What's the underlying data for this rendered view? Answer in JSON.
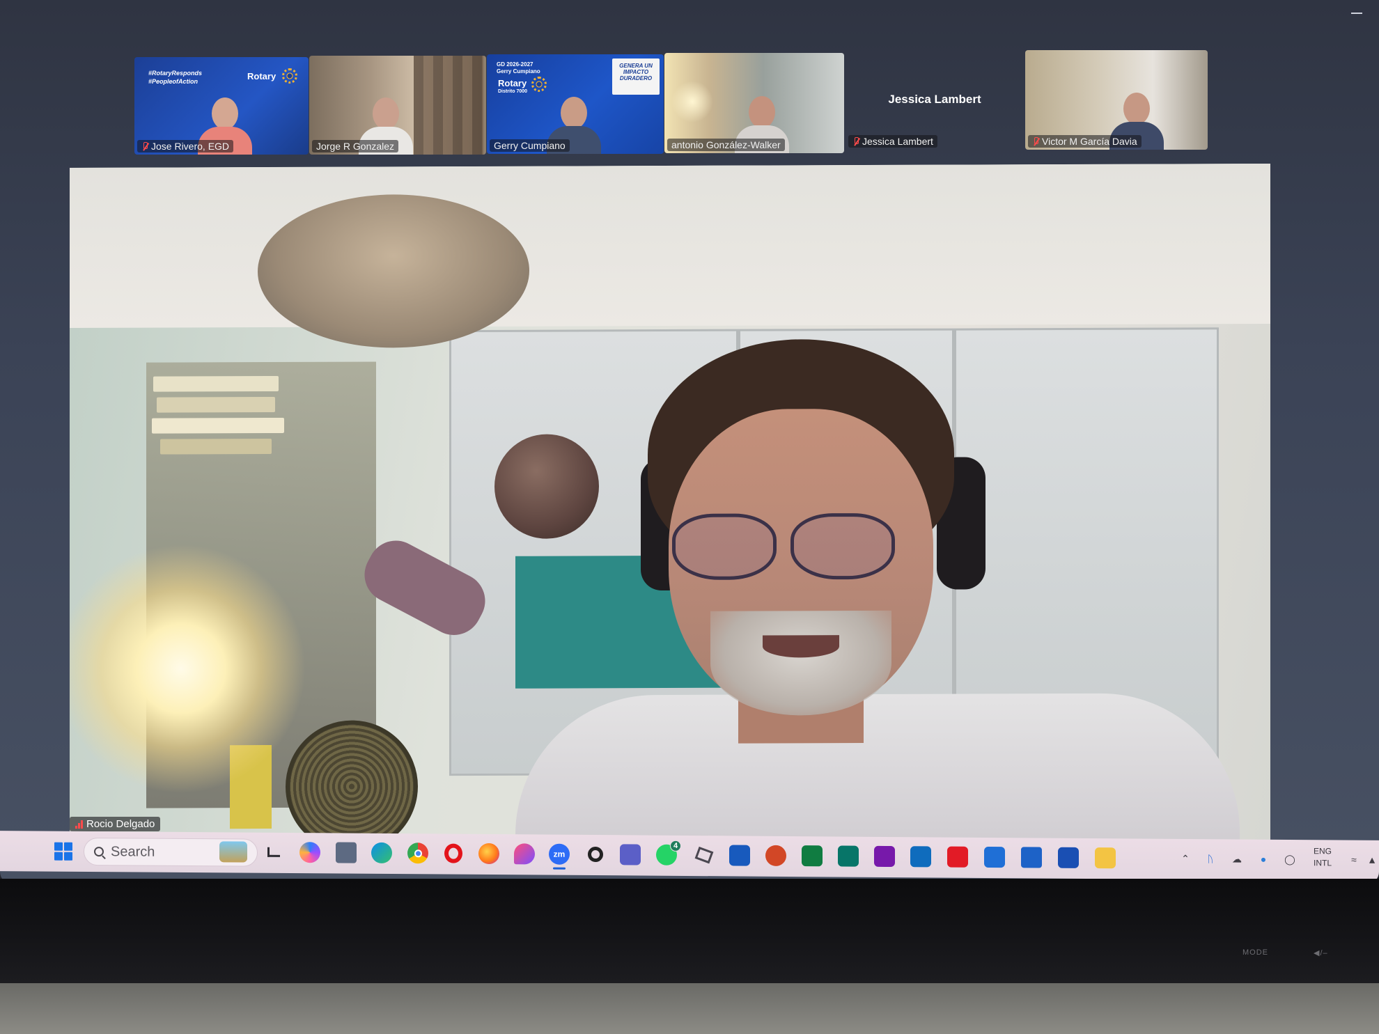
{
  "participants": {
    "thumbnails": [
      {
        "name": "Jose Rivero, EGD",
        "muted": true,
        "banner_lines": [
          "#RotaryResponds",
          "#PeopleofAction"
        ],
        "logo_text": "Rotary"
      },
      {
        "name": "Jorge R Gonzalez",
        "muted": false
      },
      {
        "name": "Gerry Cumpiano",
        "muted": false,
        "banner_lines": [
          "GD 2026-2027",
          "Gerry Cumpiano",
          "Rotary",
          "Distrito 7000"
        ],
        "slogan_lines": [
          "GENERA UN",
          "IMPACTO",
          "DURADERO"
        ]
      },
      {
        "name": "antonio González-Walker",
        "muted": false
      },
      {
        "name": "Jessica Lambert",
        "muted": true,
        "camera_off": true,
        "display_name": "Jessica Lambert"
      },
      {
        "name": "Victor M García Davia",
        "muted": true
      }
    ],
    "active_speaker": {
      "name": "Rocio Delgado"
    }
  },
  "taskbar": {
    "search_label": "Search",
    "whatsapp_badge": "4",
    "zoom_label": "zm",
    "icons": [
      "windows-start-icon",
      "search-icon",
      "widgets-icon",
      "task-view-icon",
      "copilot-icon",
      "calculator-icon",
      "edge-icon",
      "chrome-icon",
      "opera-icon",
      "firefox-icon",
      "arc-icon",
      "zoom-icon",
      "app-a-icon",
      "teams-icon",
      "whatsapp-icon",
      "snipping-icon",
      "word-icon",
      "powerpoint-icon",
      "excel-icon",
      "publisher-icon",
      "onenote-icon",
      "outlook-icon",
      "acrobat-icon",
      "remote-icon",
      "mail-icon",
      "terminal-icon",
      "file-explorer-icon"
    ]
  },
  "tray": {
    "lang_line1": "ENG",
    "lang_line2": "INTL"
  },
  "bezel": {
    "mode_label": "MODE"
  },
  "colors": {
    "accent_blue": "#1a73e8",
    "mute_red": "#ff4b4b",
    "rotary_blue": "#1c3f96",
    "rotary_gold": "#f1b233"
  }
}
